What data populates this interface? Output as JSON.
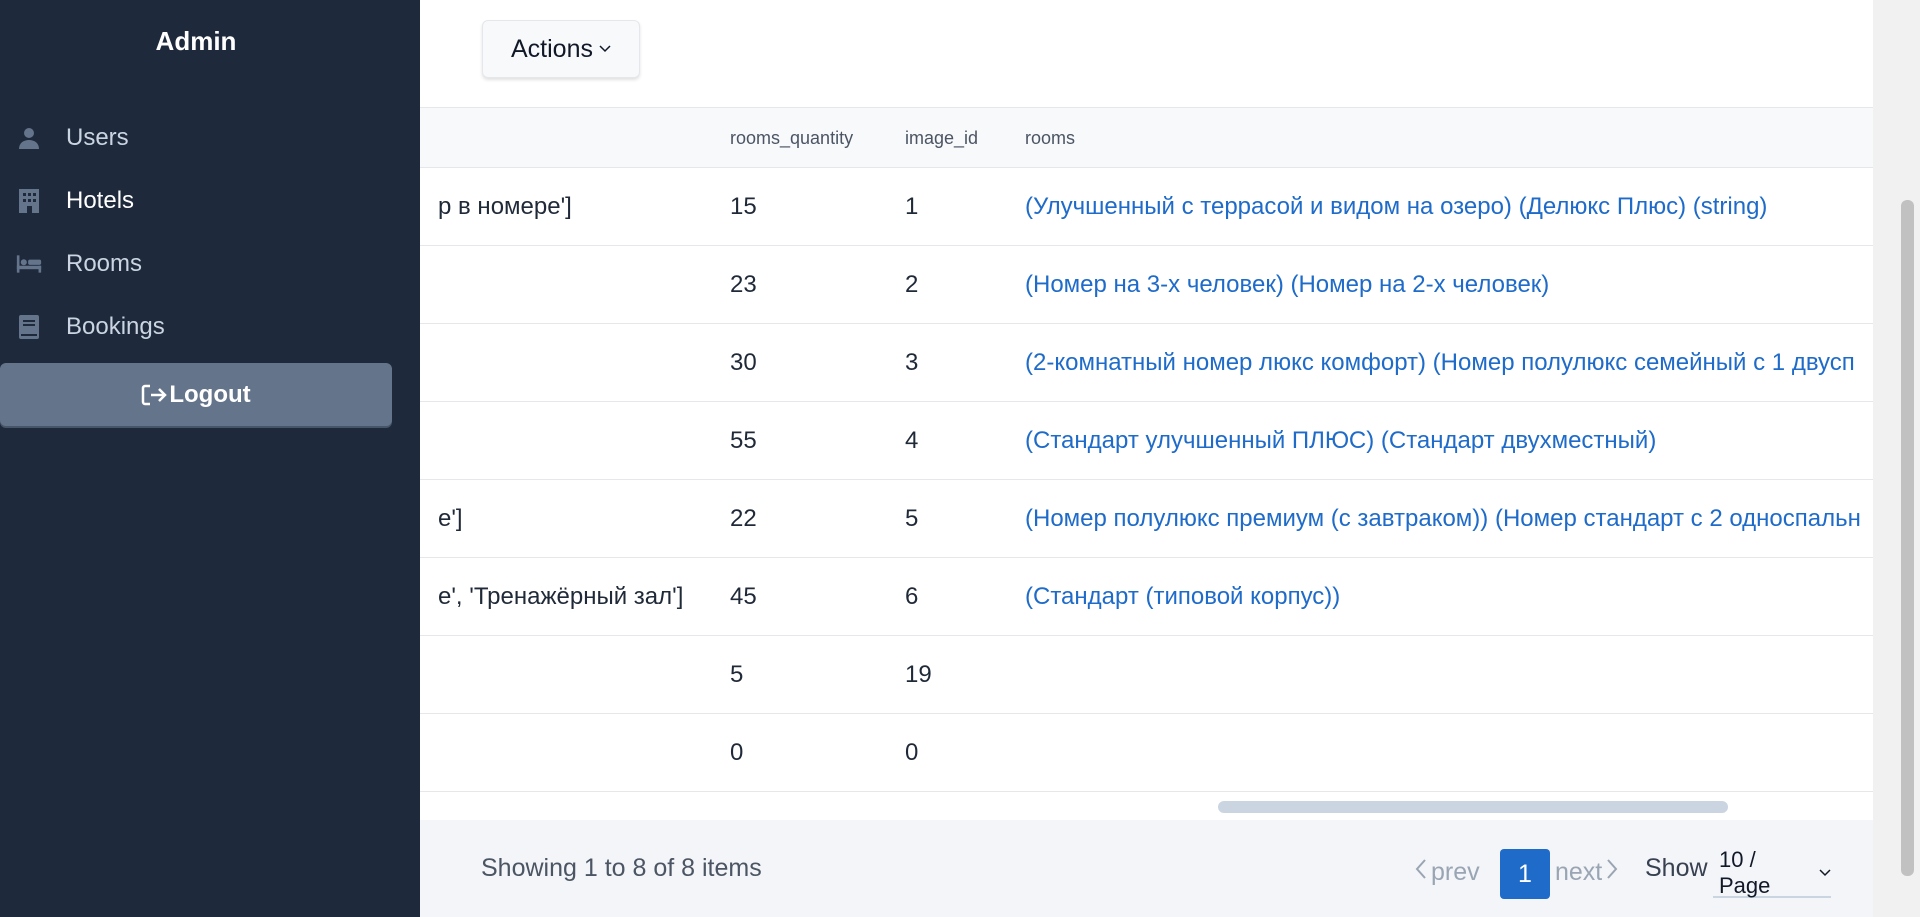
{
  "sidebar": {
    "brand": "Admin",
    "items": [
      {
        "label": "Users",
        "icon": "user-icon",
        "active": false
      },
      {
        "label": "Hotels",
        "icon": "building-icon",
        "active": true
      },
      {
        "label": "Rooms",
        "icon": "bed-icon",
        "active": false
      },
      {
        "label": "Bookings",
        "icon": "book-icon",
        "active": false
      }
    ],
    "logout_label": "Logout"
  },
  "toolbar": {
    "actions_label": "Actions"
  },
  "table": {
    "columns": [
      "rooms_quantity",
      "image_id",
      "rooms"
    ],
    "rows": [
      {
        "partial": "р в номере']",
        "rooms_quantity": "15",
        "image_id": "1",
        "rooms": "(Улучшенный с террасой и видом на озеро) (Делюкс Плюс) (string)"
      },
      {
        "partial": "",
        "rooms_quantity": "23",
        "image_id": "2",
        "rooms": "(Номер на 3-х человек) (Номер на 2-х человек)"
      },
      {
        "partial": "",
        "rooms_quantity": "30",
        "image_id": "3",
        "rooms": "(2-комнатный номер люкс комфорт) (Номер полулюкс семейный с 1 двусп"
      },
      {
        "partial": "",
        "rooms_quantity": "55",
        "image_id": "4",
        "rooms": "(Стандарт улучшенный ПЛЮС) (Стандарт двухместный)"
      },
      {
        "partial": "e']",
        "rooms_quantity": "22",
        "image_id": "5",
        "rooms": "(Номер полулюкс премиум (с завтраком)) (Номер стандарт с 2 односпальн"
      },
      {
        "partial": "e', 'Тренажёрный зал']",
        "rooms_quantity": "45",
        "image_id": "6",
        "rooms": "(Стандарт (типовой корпус))"
      },
      {
        "partial": "",
        "rooms_quantity": "5",
        "image_id": "19",
        "rooms": ""
      },
      {
        "partial": "",
        "rooms_quantity": "0",
        "image_id": "0",
        "rooms": ""
      }
    ]
  },
  "footer": {
    "showing": "Showing 1 to 8 of 8 items",
    "prev_label": "prev",
    "page": "1",
    "next_label": "next",
    "show_label": "Show",
    "per_page": "10 / Page"
  },
  "colors": {
    "sidebar_bg": "#1e293b",
    "link": "#1e6bc9",
    "page_active": "#1e6bc9",
    "logout_bg": "#64748b"
  }
}
